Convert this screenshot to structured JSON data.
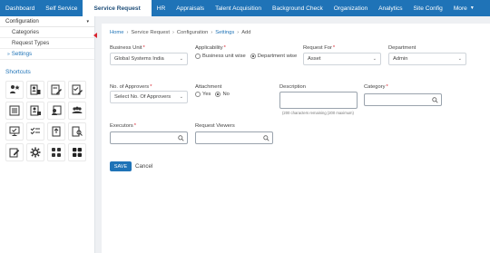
{
  "nav": {
    "items": [
      {
        "label": "Dashboard",
        "active": false
      },
      {
        "label": "Self Service",
        "active": false
      },
      {
        "label": "Service Request",
        "active": true
      },
      {
        "label": "HR",
        "active": false
      },
      {
        "label": "Appraisals",
        "active": false
      },
      {
        "label": "Talent Acquisition",
        "active": false
      },
      {
        "label": "Background Check",
        "active": false
      },
      {
        "label": "Organization",
        "active": false
      },
      {
        "label": "Analytics",
        "active": false
      },
      {
        "label": "Site Config",
        "active": false
      },
      {
        "label": "More",
        "active": false
      }
    ],
    "more_caret": "▼"
  },
  "sidebar": {
    "section_title": "Configuration",
    "section_caret": "▾",
    "links": [
      {
        "label": "Categories",
        "active": false
      },
      {
        "label": "Request Types",
        "active": false
      },
      {
        "label": "Settings",
        "active": true
      }
    ],
    "active_arrow": "»",
    "shortcuts_title": "Shortcuts",
    "shortcuts": [
      "people-star-icon",
      "person-card-icon",
      "edit-form-icon",
      "edit-check-icon",
      "checklist-icon",
      "person-report-icon",
      "person-doc-icon",
      "group-icon",
      "monitor-check-icon",
      "list-check-icon",
      "doc-upload-icon",
      "doc-search-icon",
      "edit-doc-icon",
      "gear-icon",
      "grid-icon",
      "grid-alt-icon"
    ]
  },
  "breadcrumb": {
    "home": "Home",
    "service_request": "Service Request",
    "configuration": "Configuration",
    "settings": "Settings",
    "current": "Add",
    "sep": "›"
  },
  "form": {
    "business_unit": {
      "label": "Business Unit",
      "value": "Global Systems India"
    },
    "applicability": {
      "label": "Applicability",
      "options": [
        "Business unit wise",
        "Department wise"
      ],
      "selected": "Department wise"
    },
    "request_for": {
      "label": "Request For",
      "value": "Asset"
    },
    "department": {
      "label": "Department",
      "value": "Admin"
    },
    "approvers": {
      "label": "No. of Approvers",
      "value": "Select No. Of Approvers"
    },
    "attachment": {
      "label": "Attachment",
      "options": [
        "Yes",
        "No"
      ],
      "selected": "No"
    },
    "description": {
      "label": "Description",
      "hint": "(200 characters remaining (200 maximum)"
    },
    "category": {
      "label": "Category"
    },
    "executors": {
      "label": "Executors"
    },
    "request_viewers": {
      "label": "Request Viewers"
    },
    "required_mark": "*"
  },
  "actions": {
    "save": "SAVE",
    "cancel": "Cancel"
  },
  "colors": {
    "primary": "#1f73b7",
    "required": "#d9232e"
  }
}
